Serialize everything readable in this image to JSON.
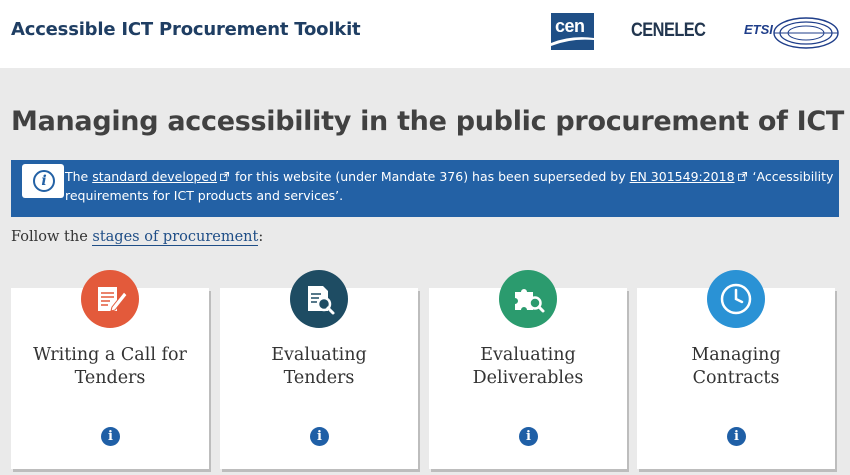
{
  "header": {
    "site_title": "Accessible ICT Procurement Toolkit",
    "logos": {
      "cen": "cen",
      "cenelec": "CENELEC",
      "etsi": "ETSI"
    }
  },
  "main": {
    "heading": "Managing accessibility in the public procurement of ICT",
    "notice": {
      "icon": "info-icon",
      "text_1": "The ",
      "link_1": "standard developed",
      "text_2": " for this website (under Mandate 376) has been superseded by ",
      "link_2": "EN 301549:2018",
      "text_3": " ‘Accessibility requirements for ICT products and services’."
    },
    "follow": {
      "prefix": "Follow the ",
      "link": "stages of procurement",
      "suffix": ":"
    },
    "cards": [
      {
        "title_line1": "Writing a Call for",
        "title_line2": "Tenders",
        "icon": "document-pen-icon",
        "color": "#e35a3b",
        "info": "i"
      },
      {
        "title_line1": "Evaluating",
        "title_line2": "Tenders",
        "icon": "document-search-icon",
        "color": "#1e4c63",
        "info": "i"
      },
      {
        "title_line1": "Evaluating",
        "title_line2": "Deliverables",
        "icon": "puzzle-search-icon",
        "color": "#2b9b6e",
        "info": "i"
      },
      {
        "title_line1": "Managing",
        "title_line2": "Contracts",
        "icon": "clock-icon",
        "color": "#2a92d5",
        "info": "i"
      }
    ]
  },
  "colors": {
    "brand_navy": "#1f3e63",
    "notice_blue": "#2361a5",
    "page_bg": "#eaeaea"
  }
}
